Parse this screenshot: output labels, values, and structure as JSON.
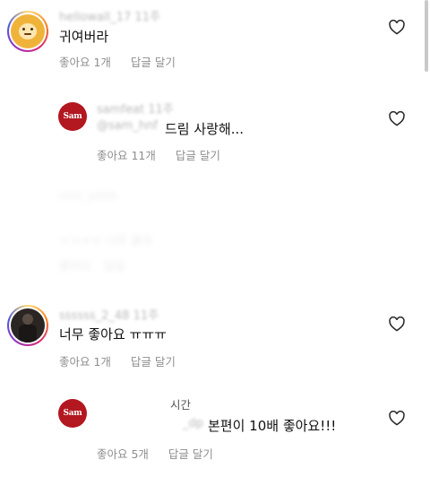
{
  "comments": [
    {
      "username": "hellowall_17",
      "timestamp": "11주",
      "text": "귀여버라",
      "likes": "좋아요 1개",
      "reply": "답글 달기"
    },
    {
      "username": "samfeat",
      "timestamp": "11주",
      "mention": "@sam_hnf",
      "text": "드림 사랑해...",
      "likes": "좋아요 11개",
      "reply": "답글 달기"
    },
    {
      "username": "rrrrr_ohhh",
      "text": "ㅠㅠㅠㅠ 너무 좋아",
      "likes": "좋아요",
      "reply": "답글"
    },
    {
      "username": "ssssss_2_48",
      "timestamp": "11주",
      "text": "너무 좋아요 ㅠㅠㅠ",
      "likes": "좋아요 1개",
      "reply": "답글 달기"
    },
    {
      "timestamp": "시간",
      "mention": "_dp",
      "text": "본편이 10배 좋아요!!!",
      "likes": "좋아요 5개",
      "reply": "답글 달기"
    }
  ],
  "avatar_badge": "Sam",
  "icons": {
    "like": "heart-outline-icon"
  },
  "colors": {
    "text": "#111111",
    "meta": "#8e8e8e",
    "sam_brand": "#b3171f"
  }
}
